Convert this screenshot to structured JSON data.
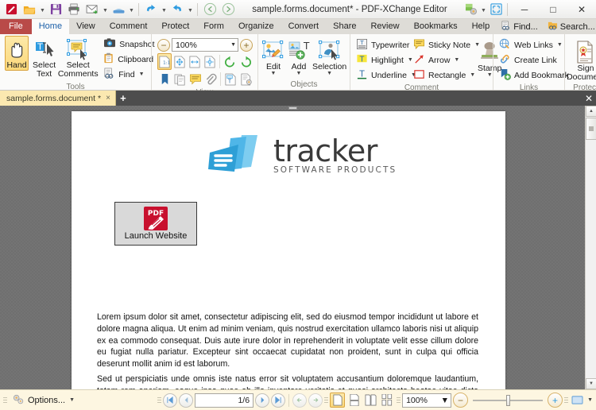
{
  "window": {
    "title": "sample.forms.document* - PDF-XChange Editor",
    "minimize_label": "─",
    "maximize_label": "□",
    "close_label": "✕"
  },
  "quick_access": {
    "items": [
      {
        "name": "app-logo",
        "label": "PDF-XChange"
      },
      {
        "name": "open-file",
        "label": "Open"
      },
      {
        "name": "save-file",
        "label": "Save"
      },
      {
        "name": "print",
        "label": "Print"
      },
      {
        "name": "email",
        "label": "Email"
      },
      {
        "name": "scan",
        "label": "Scan"
      },
      {
        "name": "undo",
        "label": "Undo"
      },
      {
        "name": "redo",
        "label": "Redo"
      },
      {
        "name": "back",
        "label": "Back"
      },
      {
        "name": "forward",
        "label": "Forward"
      }
    ]
  },
  "tabs": {
    "file": "File",
    "items": [
      {
        "label": "Home",
        "active": true
      },
      {
        "label": "View",
        "active": false
      },
      {
        "label": "Comment",
        "active": false
      },
      {
        "label": "Protect",
        "active": false
      },
      {
        "label": "Form",
        "active": false
      },
      {
        "label": "Organize",
        "active": false
      },
      {
        "label": "Convert",
        "active": false
      },
      {
        "label": "Share",
        "active": false
      },
      {
        "label": "Review",
        "active": false
      },
      {
        "label": "Bookmarks",
        "active": false
      },
      {
        "label": "Help",
        "active": false
      }
    ],
    "right_commands": [
      {
        "label": "Find...",
        "icon": "find-icon"
      },
      {
        "label": "Search...",
        "icon": "search-folder-icon"
      }
    ],
    "collapse_caret": "⌃"
  },
  "ribbon": {
    "groups": [
      {
        "id": "tools",
        "title": "Tools",
        "buttons": [
          {
            "label": "Hand",
            "selected": true
          },
          {
            "label": "Select\nText",
            "selected": false
          },
          {
            "label": "Select\nComments",
            "selected": false
          }
        ],
        "small_buttons": [
          {
            "label": "Snapshot",
            "caret": false
          },
          {
            "label": "Clipboard",
            "caret": true
          },
          {
            "label": "Find",
            "caret": true
          }
        ]
      },
      {
        "id": "view",
        "title": "View",
        "zoom_value": "100%",
        "zoom_out_label": "−",
        "zoom_in_label": "+",
        "row1_icons": [
          "actual-size-icon",
          "fit-page-icon",
          "fit-width-icon",
          "fit-visible-icon",
          "rotate-ccw-icon",
          "rotate-cw-icon"
        ],
        "row2_icons": [
          "bookmarks-pane-icon",
          "thumbnails-pane-icon",
          "comments-pane-icon",
          "attachments-pane-icon",
          "fields-pane-icon",
          "layers-pane-icon"
        ]
      },
      {
        "id": "objects",
        "title": "Objects",
        "buttons": [
          {
            "label": "Edit",
            "caret": true
          },
          {
            "label": "Add",
            "caret": true
          },
          {
            "label": "Selection",
            "caret": true
          }
        ]
      },
      {
        "id": "comment",
        "title": "Comment",
        "col1": [
          {
            "label": "Typewriter",
            "caret": true
          },
          {
            "label": "Highlight",
            "caret": true
          },
          {
            "label": "Underline",
            "caret": true
          }
        ],
        "col2": [
          {
            "label": "Sticky Note",
            "caret": true
          },
          {
            "label": "Arrow",
            "caret": true
          },
          {
            "label": "Rectangle",
            "caret": true
          }
        ],
        "stamp": {
          "label": "Stamp",
          "caret": true
        }
      },
      {
        "id": "links",
        "title": "Links",
        "items": [
          {
            "label": "Web Links",
            "caret": true
          },
          {
            "label": "Create Link",
            "caret": false
          },
          {
            "label": "Add Bookmark",
            "caret": false
          }
        ]
      },
      {
        "id": "protect",
        "title": "Protect",
        "button": {
          "label": "Sign\nDocument"
        }
      }
    ]
  },
  "document_tabs": {
    "items": [
      {
        "label": "sample.forms.document *",
        "close": "×"
      }
    ],
    "new_tab": "+",
    "close_all": "✕"
  },
  "page_content": {
    "logo": {
      "word": "tracker",
      "sub": "SOFTWARE PRODUCTS"
    },
    "form_button": {
      "icon_text": "PDF",
      "label": "Launch Website"
    },
    "paragraph1": "Lorem ipsum dolor sit amet, consectetur adipiscing elit, sed do eiusmod tempor incididunt ut labore et dolore magna aliqua. Ut enim ad minim veniam, quis nostrud exercitation ullamco laboris nisi ut aliquip ex ea commodo consequat. Duis aute irure dolor in reprehenderit in voluptate velit esse cillum dolore eu fugiat nulla pariatur. Excepteur sint occaecat cupidatat non proident, sunt in culpa qui officia deserunt mollit anim id est laborum.",
    "paragraph2": "Sed ut perspiciatis unde omnis iste natus error sit voluptatem accusantium doloremque laudantium, totam rem aperiam, eaque ipsa quae ab illo inventore veritatis et quasi architecto beatae vitae dicta sunt"
  },
  "statusbar": {
    "options_label": "Options...",
    "page_value": "1/6",
    "first_page": "❘◀",
    "prev_page": "◀",
    "next_page": "▶",
    "last_page": "▶❘",
    "back_nav": "←",
    "forward_nav": "→",
    "zoom_value": "100%",
    "zoom_out": "−",
    "zoom_in": "+",
    "view_modes": [
      "single-page-icon",
      "continuous-icon",
      "two-page-icon",
      "two-page-continuous-icon",
      "book-icon",
      "book-continuous-icon"
    ],
    "fullscreen_label": "Full Screen"
  },
  "colors": {
    "file_tab": "#b94a48",
    "active_tab_text": "#1a5fa8",
    "doc_tab": "#fbe8b0",
    "statusbar": "#fdf6e1",
    "logo_blue_dark": "#2e9fd6",
    "logo_blue_light": "#7ecdf0",
    "pdf_red": "#c8102e"
  }
}
